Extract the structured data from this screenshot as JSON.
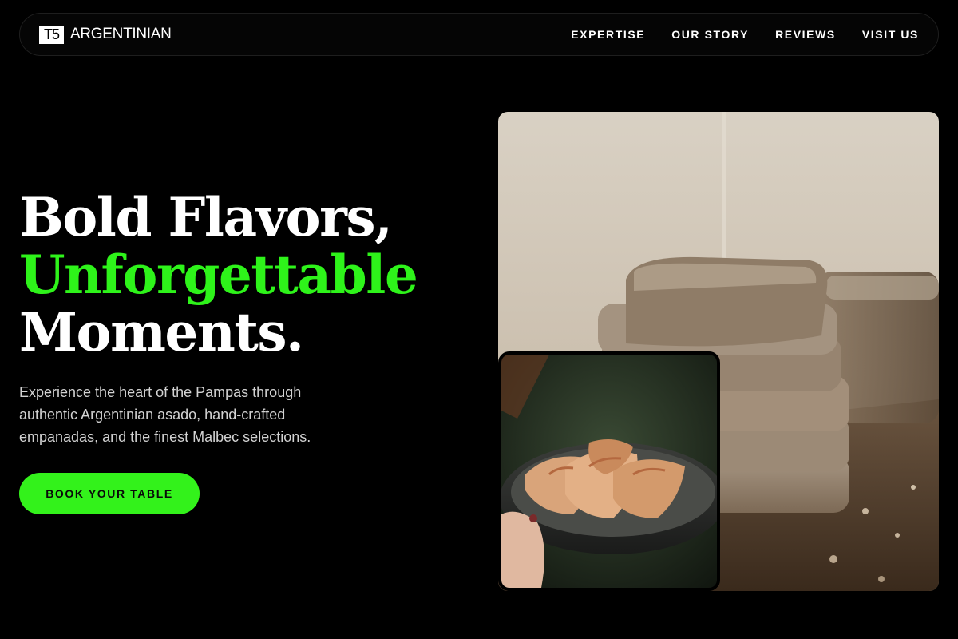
{
  "brand": {
    "mark": "T5",
    "name": "ARGENTINIAN"
  },
  "nav": {
    "items": [
      {
        "label": "EXPERTISE"
      },
      {
        "label": "OUR STORY"
      },
      {
        "label": "REVIEWS"
      },
      {
        "label": "VISIT US"
      }
    ]
  },
  "hero": {
    "title_line1": "Bold Flavors,",
    "title_line2": "Unforgettable",
    "title_line3": "Moments.",
    "subtitle": "Experience the heart of the Pampas through authentic Argentinian asado, hand-crafted empanadas, and the finest Malbec selections.",
    "cta_label": "BOOK YOUR TABLE"
  },
  "colors": {
    "background": "#000000",
    "accent": "#2ef31a",
    "text": "#ffffff",
    "muted": "#d2d2d2"
  },
  "images": {
    "main": "bread-loaf-photo",
    "inset": "empanadas-plate-photo"
  }
}
